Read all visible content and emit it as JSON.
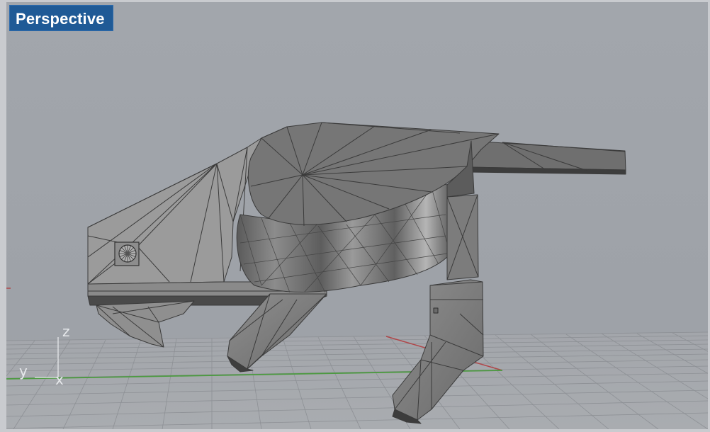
{
  "viewport": {
    "label": "Perspective"
  },
  "axes": {
    "x": "x",
    "y": "y",
    "z": "z"
  },
  "colors": {
    "viewport_label_bg": "#1f5a96",
    "background": "#9ea2a8",
    "grid_line": "#8a8d92",
    "x_axis": "#b0474a",
    "y_axis": "#4c9a40",
    "mesh_edge": "#3a3a3a"
  },
  "icons": {
    "axis_gizmo": "xyz-axis-icon",
    "circular_port": "circular-vent-icon"
  }
}
